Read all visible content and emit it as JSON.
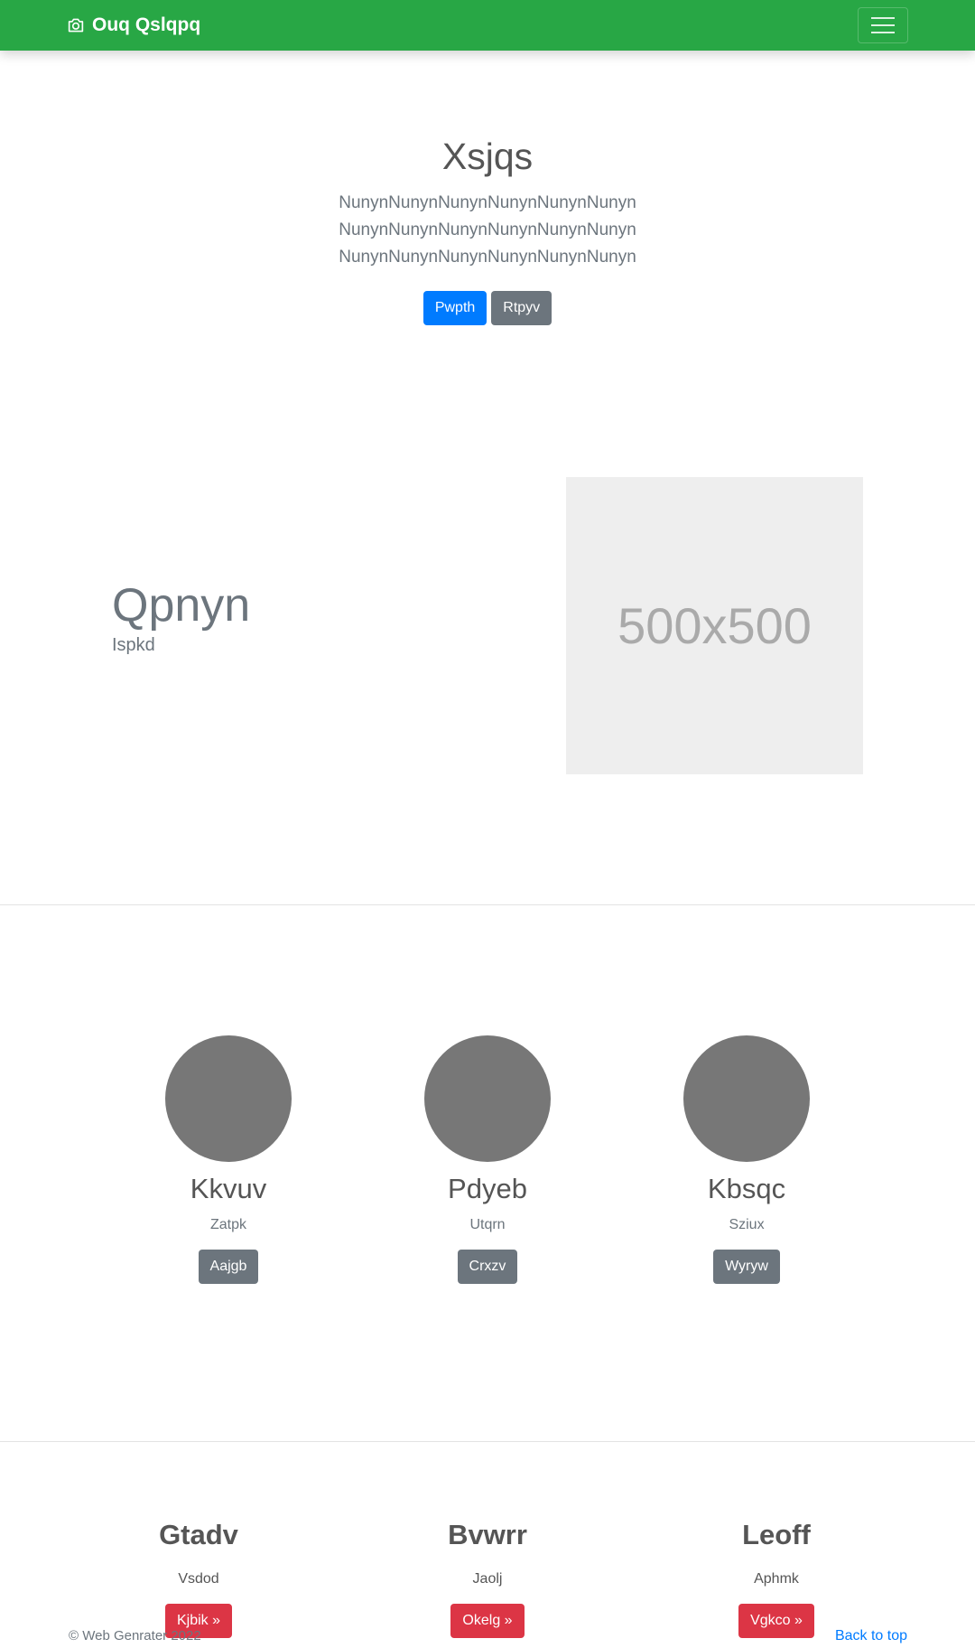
{
  "navbar": {
    "brand_text": "Ouq Qslqpq",
    "brand_icon": "camera-icon",
    "toggler_icon": "hamburger-menu-icon",
    "bg_color": "#28a745"
  },
  "hero": {
    "title": "Xsjqs",
    "lead": "NunynNunynNunynNunynNunynNunynNunynNunynNunynNunynNunynNunynNunynNunynNunynNunynNunynNunyn",
    "primary_label": "Pwpth",
    "secondary_label": "Rtpyv"
  },
  "feature": {
    "heading": "Qpnyn",
    "subheading": "Ispkd",
    "image_label": "500x500"
  },
  "people": [
    {
      "name": "Kkvuv",
      "role": "Zatpk",
      "button": "Aajgb"
    },
    {
      "name": "Pdyeb",
      "role": "Utqrn",
      "button": "Crxzv"
    },
    {
      "name": "Kbsqc",
      "role": "Sziux",
      "button": "Wyryw"
    }
  ],
  "columns": [
    {
      "title": "Gtadv",
      "text": "Vsdod",
      "button": "Kjbik »"
    },
    {
      "title": "Bvwrr",
      "text": "Jaolj",
      "button": "Okelg »"
    },
    {
      "title": "Leoff",
      "text": "Aphmk",
      "button": "Vgkco »"
    }
  ],
  "footer": {
    "copyright": "© Web Genrater 2022",
    "back_to_top": "Back to top"
  },
  "colors": {
    "primary": "#007bff",
    "secondary": "#6c757d",
    "danger": "#dc3545",
    "success": "#28a745"
  }
}
